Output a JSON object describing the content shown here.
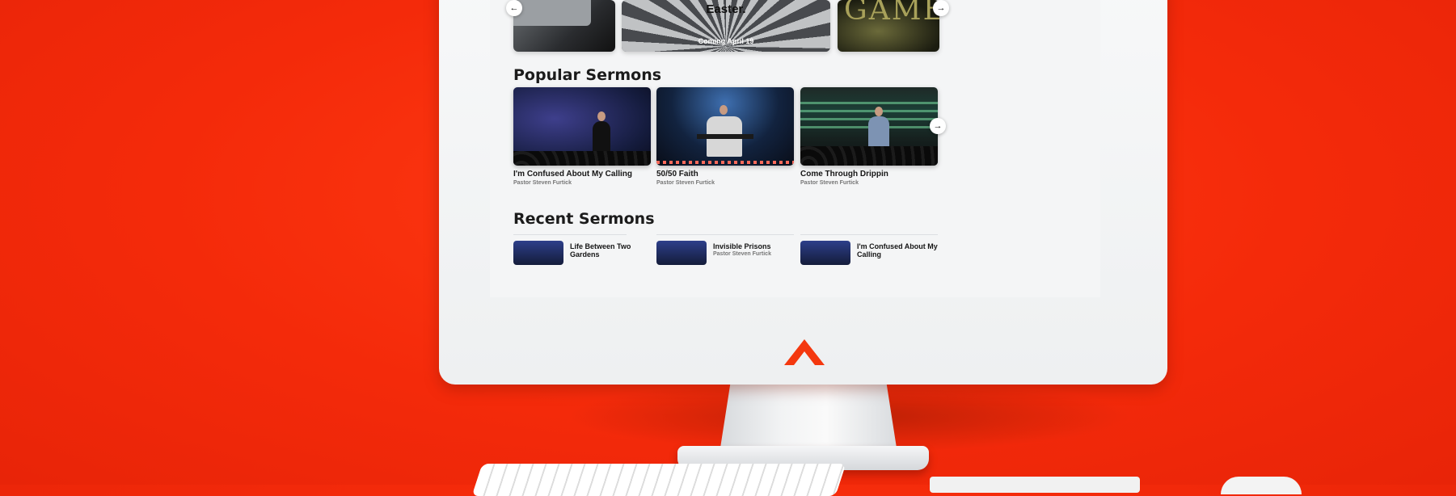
{
  "colors": {
    "background_orange": "#f42a0a",
    "monitor_white": "#f4f5f6",
    "logo_orange": "#f4380f"
  },
  "icons": {
    "prev_arrow": "←",
    "next_arrow": "→",
    "brand_logo": "chevron-up-logo"
  },
  "featured": {
    "cards": [
      {
        "title": "",
        "subtitle": ""
      },
      {
        "title": "Easter.",
        "subtitle": "Coming April 19"
      },
      {
        "title": "GAME",
        "subtitle": ""
      }
    ]
  },
  "popular": {
    "heading": "Popular Sermons",
    "items": [
      {
        "title": "I'm Confused About My Calling",
        "pastor": "Pastor Steven Furtick"
      },
      {
        "title": "50/50 Faith",
        "pastor": "Pastor Steven Furtick"
      },
      {
        "title": "Come Through Drippin",
        "pastor": "Pastor Steven Furtick"
      }
    ]
  },
  "recent": {
    "heading": "Recent Sermons",
    "items": [
      {
        "title": "Life Between Two Gardens",
        "pastor": ""
      },
      {
        "title": "Invisible Prisons",
        "pastor": "Pastor Steven Furtick"
      },
      {
        "title": "I'm Confused About My Calling",
        "pastor": ""
      }
    ]
  }
}
